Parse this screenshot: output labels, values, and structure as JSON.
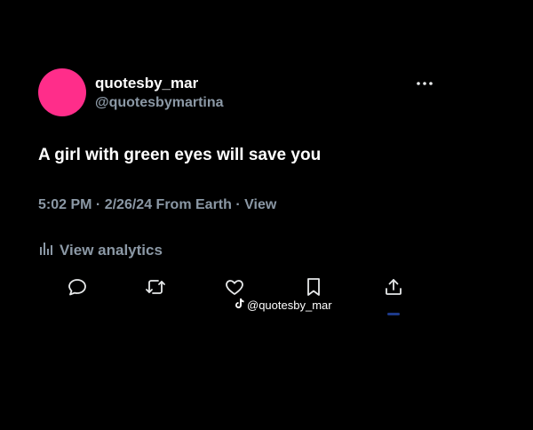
{
  "user": {
    "display_name": "quotesby_mar",
    "handle": "@quotesbymartina",
    "avatar_color": "#ff2d8a"
  },
  "tweet": {
    "text": "A girl with green eyes will save you",
    "time": "5:02 PM",
    "date": "2/26/24",
    "location": "From Earth",
    "view_label": "View"
  },
  "analytics": {
    "label": "View analytics",
    "icon": "bar-chart-icon"
  },
  "actions": {
    "icons": [
      "reply-icon",
      "retweet-icon",
      "like-icon",
      "bookmark-icon",
      "share-icon"
    ]
  },
  "watermark": {
    "icon": "tiktok-icon",
    "text": "@quotesby_mar"
  },
  "menu": {
    "icon": "more-options-icon"
  }
}
